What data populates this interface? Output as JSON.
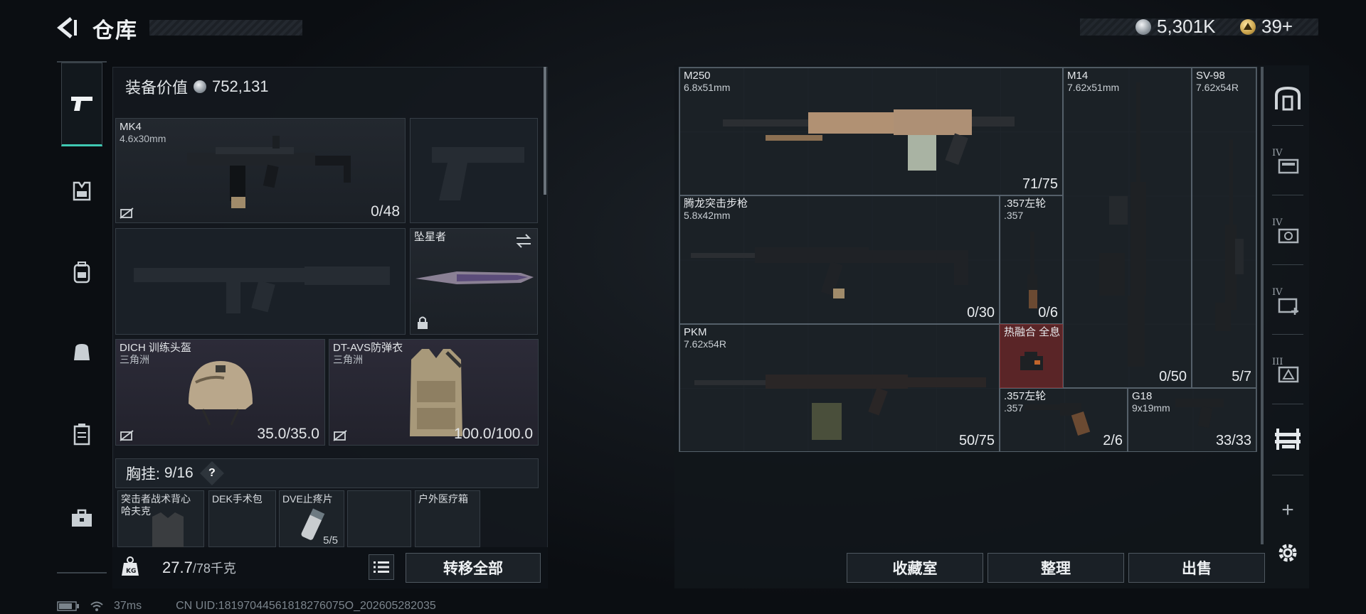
{
  "header": {
    "title": "仓库"
  },
  "currency": {
    "silver": "5,301K",
    "gold": "39+"
  },
  "left_nav": {
    "items": [
      "weapons",
      "gear",
      "backpack",
      "pack",
      "supplies",
      "medkit"
    ]
  },
  "equipment": {
    "value_label": "装备价值",
    "value": "752,131",
    "primary": {
      "name": "MK4",
      "caliber": "4.6x30mm",
      "ammo": "0/48"
    },
    "melee": {
      "name": "坠星者"
    },
    "helmet": {
      "name": "DICH 训练头盔",
      "source": "三角洲",
      "durability": "35.0/35.0"
    },
    "armor": {
      "name": "DT-AVS防弹衣",
      "source": "三角洲",
      "durability": "100.0/100.0"
    },
    "chest_rig": {
      "label": "胸挂:",
      "capacity": "9/16",
      "help": "?"
    },
    "rig_items": [
      {
        "name": "突击者战术背心",
        "sub": "哈夫克"
      },
      {
        "name": "DEK手术包",
        "sub": ""
      },
      {
        "name": "DVE止疼片",
        "sub": "",
        "count": "5/5"
      },
      {
        "name": "",
        "sub": ""
      },
      {
        "name": "户外医疗箱",
        "sub": ""
      }
    ],
    "weight": {
      "current": "27.7",
      "max": "/78千克"
    },
    "transfer_all": "转移全部"
  },
  "stash": {
    "items": [
      {
        "name": "M250",
        "caliber": "6.8x51mm",
        "count": "71/75"
      },
      {
        "name": "M14",
        "caliber": "7.62x51mm",
        "count": "0/50"
      },
      {
        "name": "SV-98",
        "caliber": "7.62x54R",
        "count": "5/7"
      },
      {
        "name": "腾龙突击步枪",
        "caliber": "5.8x42mm",
        "count": "0/30"
      },
      {
        "name": ".357左轮",
        "caliber": ".357",
        "count": "0/6"
      },
      {
        "name": "PKM",
        "caliber": "7.62x54R",
        "count": "50/75"
      },
      {
        "name": "热融合 全息",
        "caliber": "",
        "count": ""
      },
      {
        "name": ".357左轮",
        "caliber": ".357",
        "count": "2/6"
      },
      {
        "name": "G18",
        "caliber": "9x19mm",
        "count": "33/33"
      }
    ]
  },
  "right_tabs": [
    {
      "icon": "stash-home-icon",
      "label": ""
    },
    {
      "icon": "container-iv-icon",
      "label": "IV"
    },
    {
      "icon": "container-iv-repair-icon",
      "label": "IV"
    },
    {
      "icon": "container-iv-medical-icon",
      "label": "IV"
    },
    {
      "icon": "container-iii-warning-icon",
      "label": "III"
    },
    {
      "icon": "shelf-icon",
      "label": ""
    },
    {
      "icon": "add-icon",
      "label": "+"
    },
    {
      "icon": "settings-icon",
      "label": ""
    }
  ],
  "actions": {
    "collection": "收藏室",
    "sort": "整理",
    "sell": "出售"
  },
  "status": {
    "ping": "37ms",
    "uid": "CN UID:18197044561818276075O_202605282035"
  },
  "colors": {
    "accent": "#3fc9b3",
    "red_highlight": "#5a2527"
  }
}
